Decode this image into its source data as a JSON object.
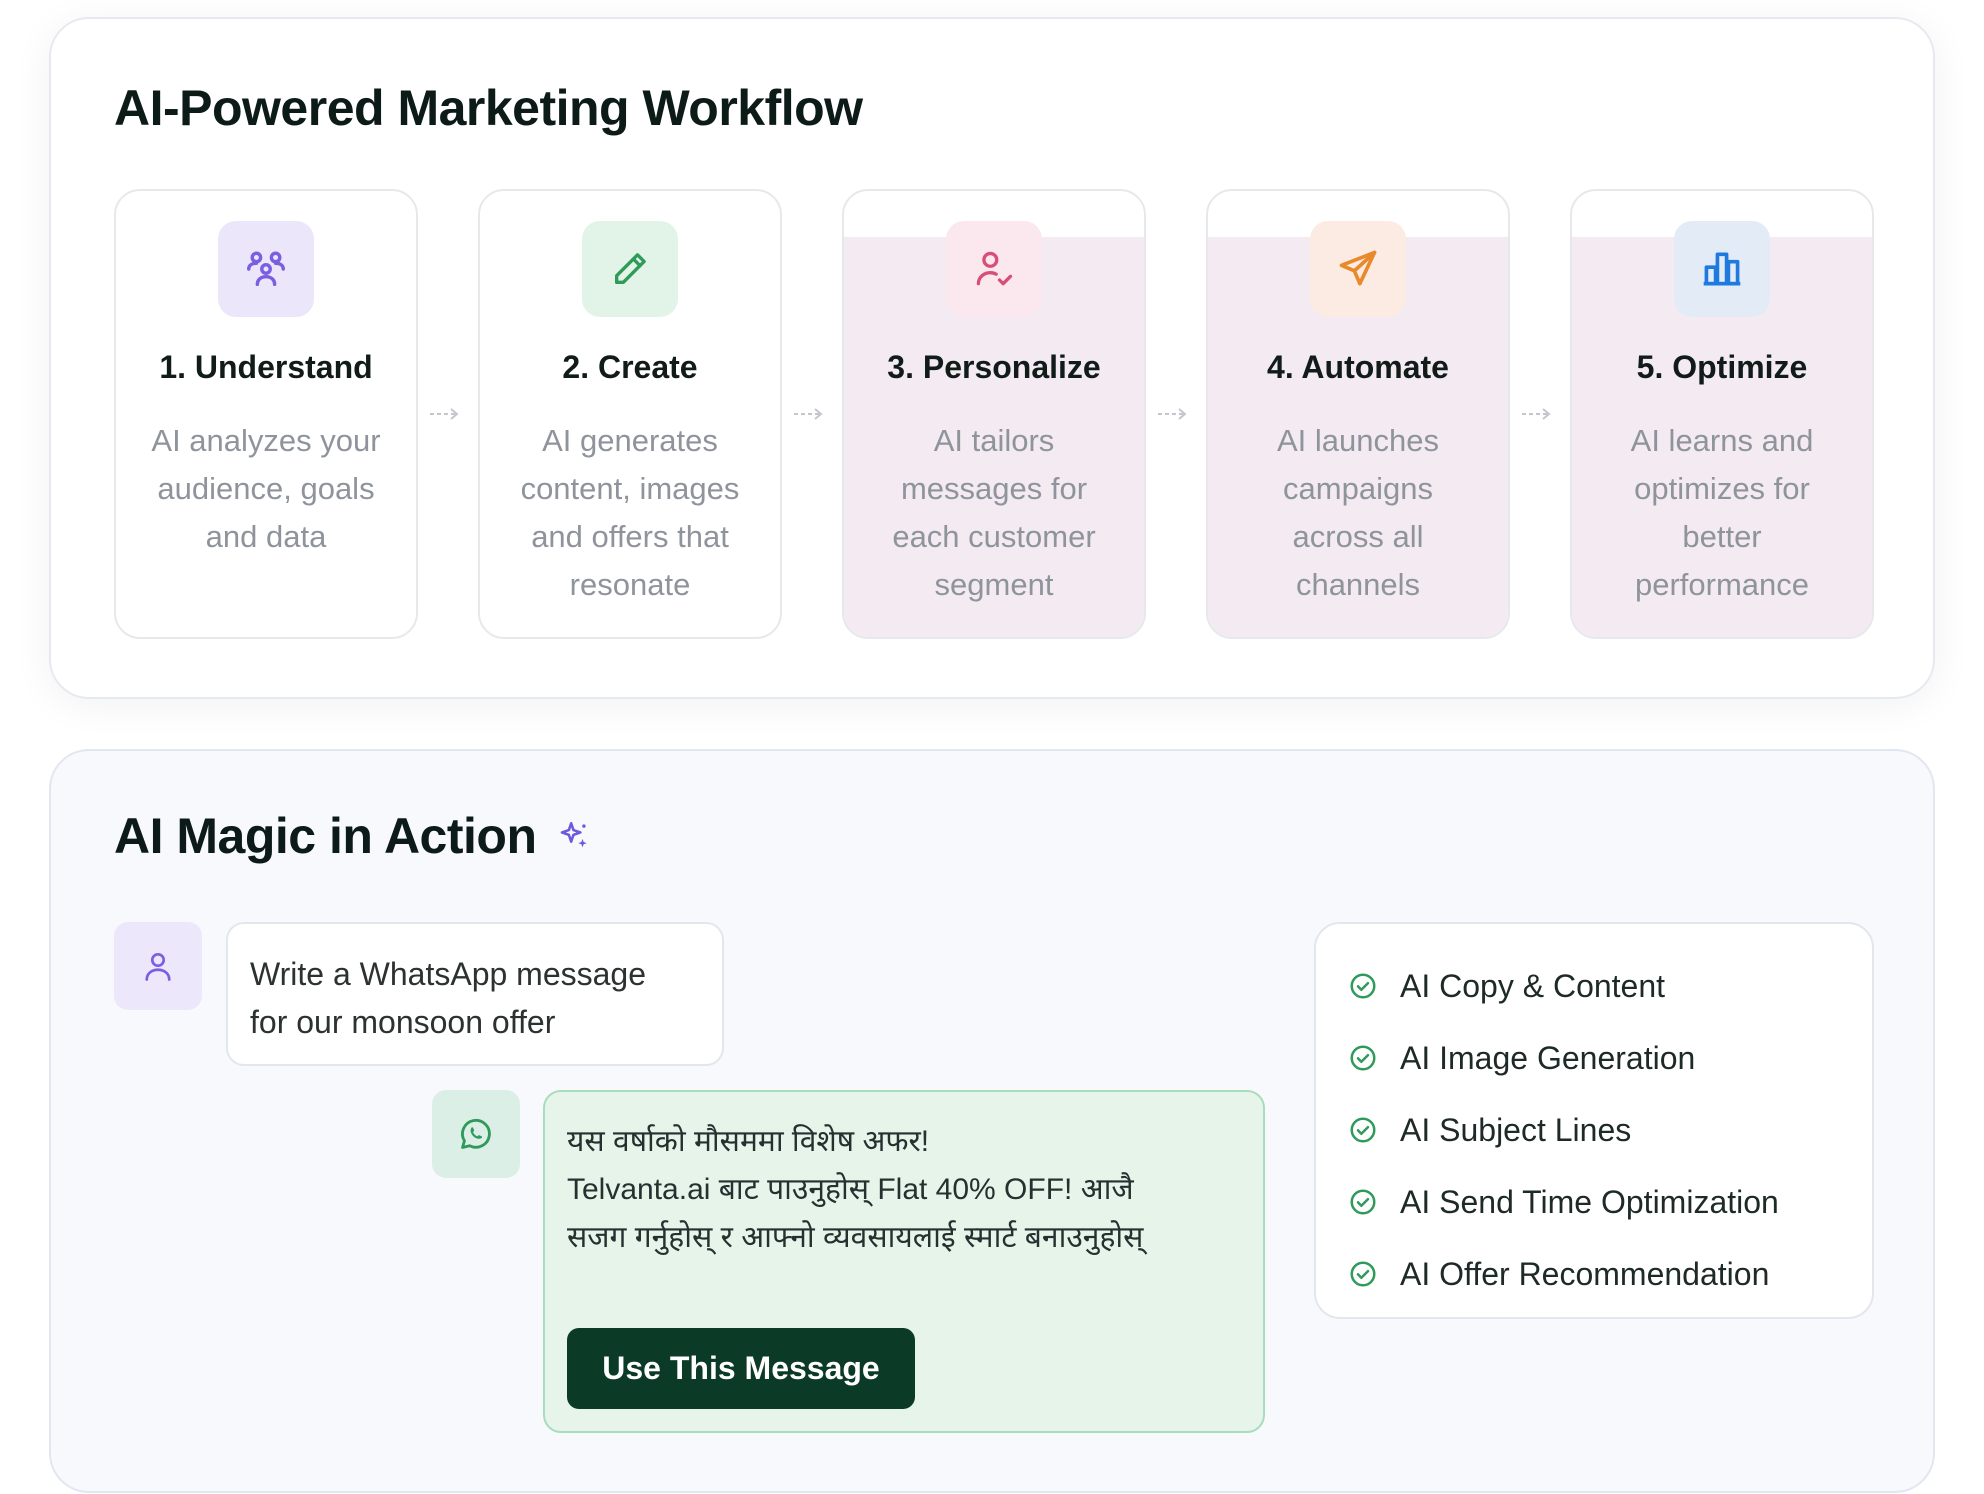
{
  "workflow": {
    "title": "AI-Powered Marketing Workflow",
    "steps": [
      {
        "title": "1. Understand",
        "desc": [
          "AI analyzes your",
          "audience, goals",
          "and data"
        ],
        "icon": "users-icon",
        "icon_color": "#7b5fe0",
        "icon_bg": "#ece6fb"
      },
      {
        "title": "2. Create",
        "desc": [
          "AI generates",
          "content, images",
          "and offers that",
          "resonate"
        ],
        "icon": "pencil-icon",
        "icon_color": "#2f9a5a",
        "icon_bg": "#e2f3e8"
      },
      {
        "title": "3. Personalize",
        "desc": [
          "AI tailors",
          "messages for",
          "each customer",
          "segment"
        ],
        "icon": "user-check-icon",
        "icon_color": "#d94d79",
        "icon_bg": "#fbe8ee"
      },
      {
        "title": "4. Automate",
        "desc": [
          "AI launches",
          "campaigns",
          "across all",
          "channels"
        ],
        "icon": "send-icon",
        "icon_color": "#e88a2c",
        "icon_bg": "#fcebe2"
      },
      {
        "title": "5. Optimize",
        "desc": [
          "AI learns and",
          "optimizes for",
          "better",
          "performance"
        ],
        "icon": "bar-chart-icon",
        "icon_color": "#1f7ae0",
        "icon_bg": "#e3ecf6"
      }
    ]
  },
  "magic": {
    "title": "AI Magic in Action",
    "title_icon": "sparkles-icon",
    "user_message": [
      "Write a WhatsApp message",
      "for our monsoon offer"
    ],
    "ai_message": [
      "यस वर्षाको मौसममा विशेष अफर!",
      "Telvanta.ai बाट पाउनुहोस् Flat 40% OFF! आजै",
      "सजग गर्नुहोस् र आफ्नो व्यवसायलाई स्मार्ट बनाउनुहोस्"
    ],
    "use_button_label": "Use This Message",
    "features": [
      "AI Copy & Content",
      "AI Image Generation",
      "AI Subject Lines",
      "AI Send Time Optimization",
      "AI Offer Recommendation"
    ]
  },
  "colors": {
    "accent_green": "#0b3a26",
    "check_green": "#2f9a5a",
    "whatsapp_green": "#2f9a5a",
    "user_purple": "#7b5fe0"
  }
}
